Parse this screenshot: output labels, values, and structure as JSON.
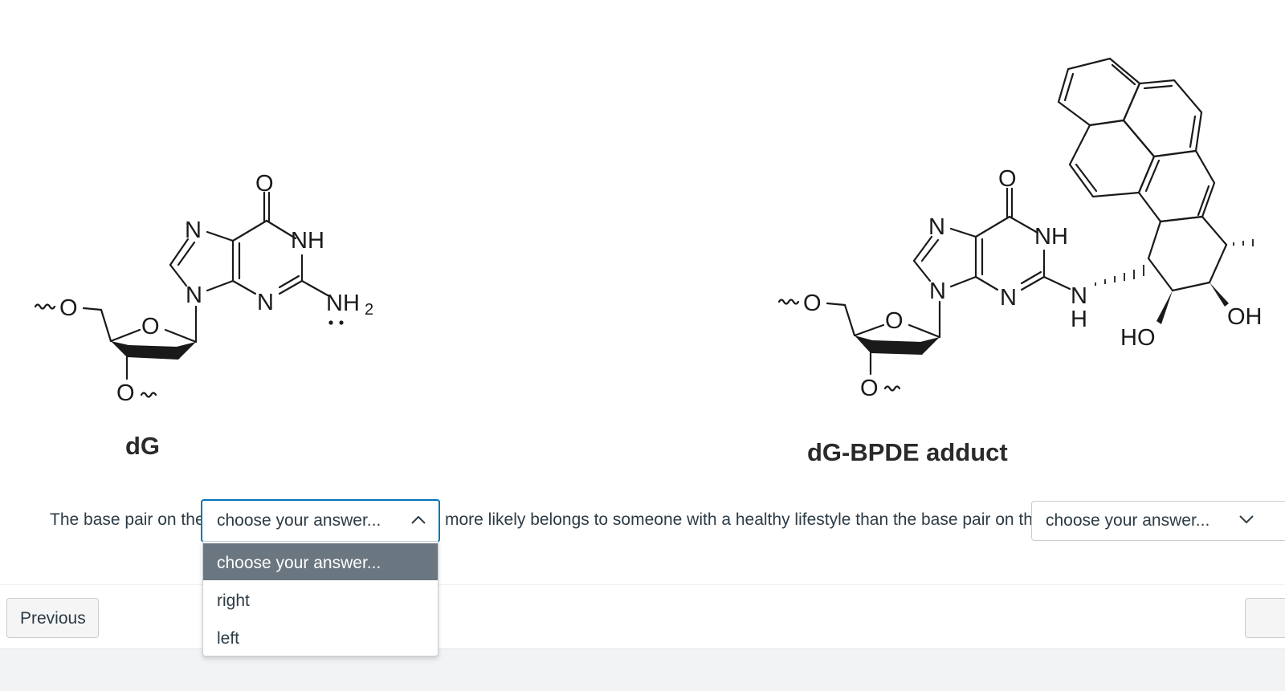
{
  "figure": {
    "left_molecule": {
      "name": "dG",
      "atoms": {
        "o_carbonyl": "O",
        "n7": "N",
        "nh": "NH",
        "n9": "N",
        "n3": "N",
        "nh2": "NH",
        "nh2_sub": "2",
        "o_ring": "O",
        "o5": "O",
        "o3": "O"
      }
    },
    "right_molecule": {
      "name": "dG-BPDE adduct",
      "atoms": {
        "o_carbonyl": "O",
        "n7": "N",
        "nh": "NH",
        "n9": "N",
        "n3": "N",
        "n_link": "N",
        "h_link": "H",
        "o_ring": "O",
        "o5": "O",
        "o3": "O",
        "ho": "HO",
        "oh": "OH"
      }
    }
  },
  "question": {
    "text_before": "The base pair on the",
    "text_middle": "more likely belongs to someone with a healthy lifestyle than the base pair on the",
    "select1": {
      "value": "choose your answer...",
      "state": "open"
    },
    "select2": {
      "value": "choose your answer...",
      "state": "closed"
    },
    "options": [
      "choose your answer...",
      "right",
      "left"
    ]
  },
  "nav": {
    "previous_label": "Previous"
  },
  "colors": {
    "accent": "#0374b5",
    "selected_option_bg": "#6b7780",
    "text": "#2d3b45",
    "border": "#c7cdd1"
  }
}
